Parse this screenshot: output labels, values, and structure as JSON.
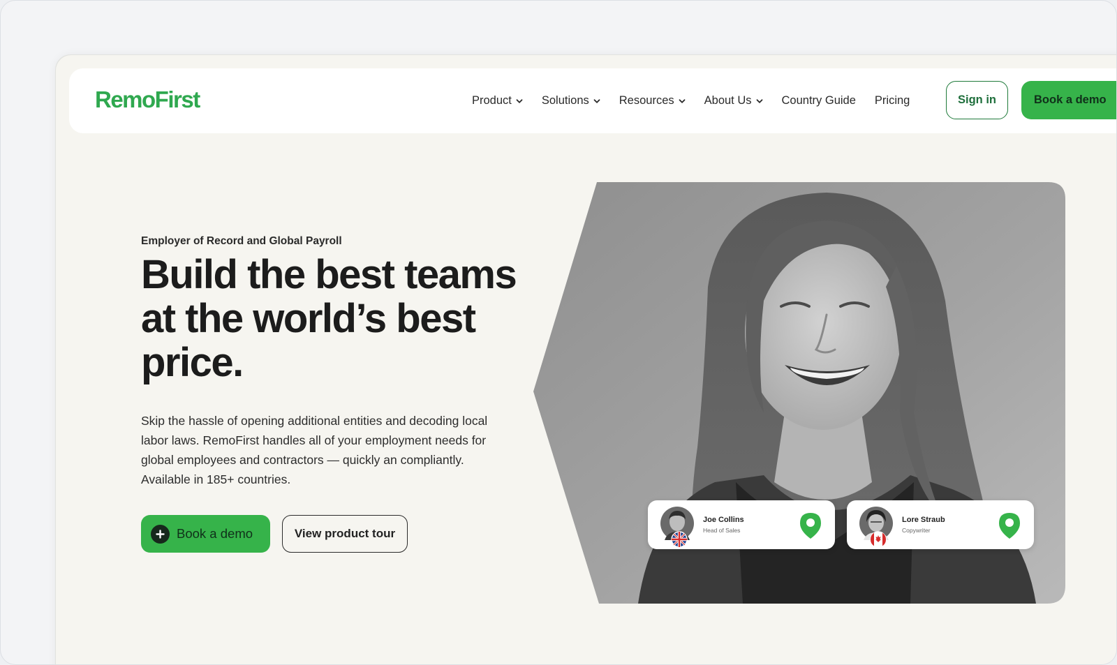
{
  "brand": {
    "logo_text": "RemoFirst",
    "accent_color": "#36b34a",
    "logo_color": "#2fa84f"
  },
  "nav": {
    "items": [
      {
        "label": "Product",
        "has_dropdown": true
      },
      {
        "label": "Solutions",
        "has_dropdown": true
      },
      {
        "label": "Resources",
        "has_dropdown": true
      },
      {
        "label": "About Us",
        "has_dropdown": true
      },
      {
        "label": "Country Guide",
        "has_dropdown": false
      },
      {
        "label": "Pricing",
        "has_dropdown": false
      }
    ],
    "sign_in_label": "Sign in",
    "book_demo_label": "Book a demo"
  },
  "hero": {
    "eyebrow": "Employer of Record and Global Payroll",
    "headline": "Build the best teams at the world’s best price.",
    "description": "Skip the hassle of opening additional entities and decoding local labor laws. RemoFirst handles all of your employment needs for global employees and contractors — quickly an compliantly. Available in 185+ countries.",
    "primary_cta": "Book a demo",
    "primary_cta_icon": "plus-circle-icon",
    "secondary_cta": "View product tour"
  },
  "people_cards": [
    {
      "name": "Joe Collins",
      "role": "Head of Sales",
      "flag": "uk-flag-icon",
      "pin_icon": "location-pin-icon"
    },
    {
      "name": "Lore Straub",
      "role": "Copywriter",
      "flag": "canada-flag-icon",
      "pin_icon": "location-pin-icon"
    }
  ]
}
